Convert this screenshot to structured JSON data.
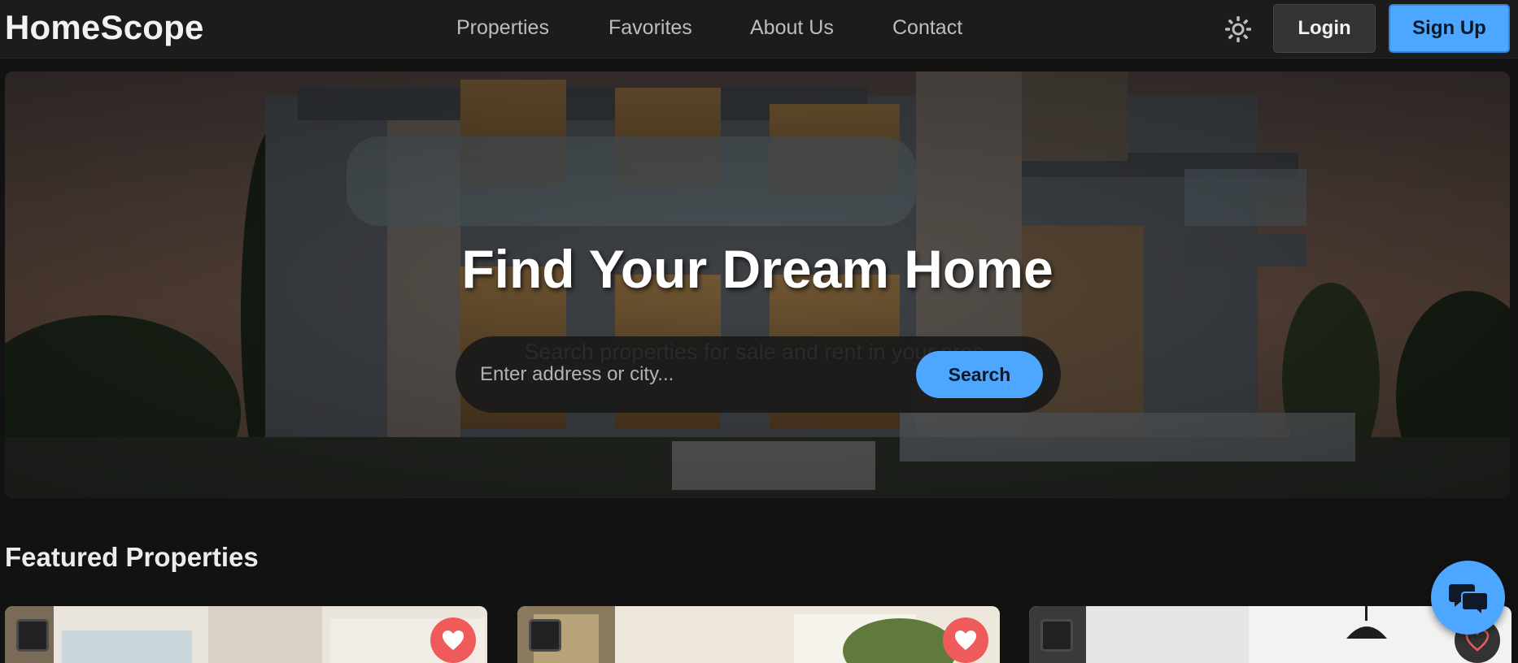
{
  "brand": {
    "name": "HomeScope"
  },
  "nav": {
    "links": [
      "Properties",
      "Favorites",
      "About Us",
      "Contact"
    ],
    "theme_toggle_icon": "sun-icon",
    "login_label": "Login",
    "signup_label": "Sign Up"
  },
  "hero": {
    "title": "Find Your Dream Home",
    "subtitle": "Search properties for sale and rent in your area.",
    "search_placeholder": "Enter address or city...",
    "search_button": "Search"
  },
  "featured": {
    "title": "Featured Properties",
    "cards": [
      {
        "favorite_icon": "heart-icon",
        "favorited": true
      },
      {
        "favorite_icon": "heart-icon",
        "favorited": true
      },
      {
        "favorite_icon": "heart-icon",
        "favorited": false
      }
    ]
  },
  "chat": {
    "icon": "chat-bubbles-icon"
  },
  "colors": {
    "accent": "#4da6ff",
    "background": "#121212",
    "navbar": "#1c1c1c",
    "favorite": "#ef5b5b"
  }
}
